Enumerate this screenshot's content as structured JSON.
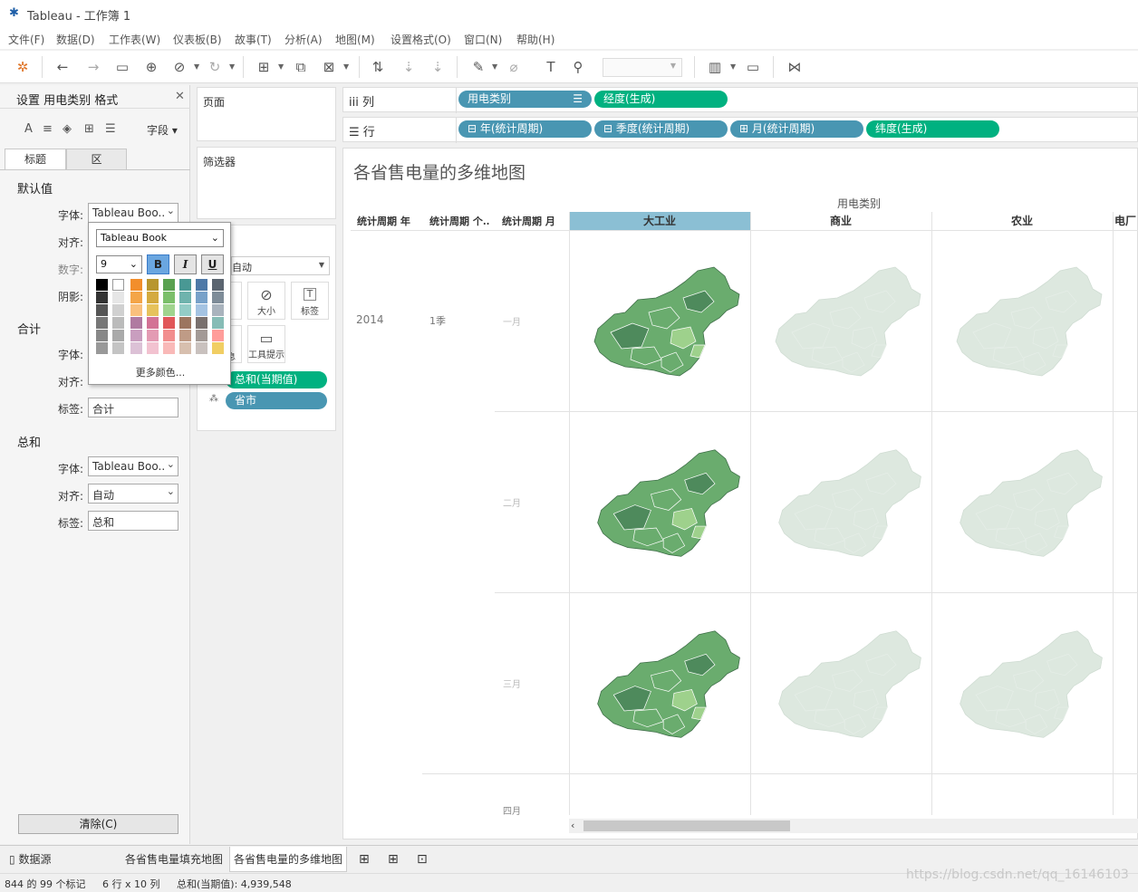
{
  "window": {
    "title": "Tableau - 工作簿 1"
  },
  "menu": [
    "文件(F)",
    "数据(D)",
    "工作表(W)",
    "仪表板(B)",
    "故事(T)",
    "分析(A)",
    "地图(M)",
    "设置格式(O)",
    "窗口(N)",
    "帮助(H)"
  ],
  "format_pane": {
    "title": "设置 用电类别 格式",
    "fields_label": "字段",
    "tabs": [
      "标题",
      "区"
    ],
    "default_section": "默认值",
    "font_label": "字体:",
    "align_label": "对齐:",
    "number_label": "数字:",
    "shading_label": "阴影:",
    "default_font_value": "Tableau Boo..",
    "subtotal_section": "合计",
    "subtotal_label_label": "标签:",
    "subtotal_label_value": "合计",
    "total_section": "总和",
    "total_font_value": "Tableau Boo..",
    "total_align_value": "自动",
    "total_label_value": "总和",
    "clear_button": "清除(C)"
  },
  "font_popup": {
    "font_name": "Tableau Book",
    "font_size": "9",
    "bold": "B",
    "italic": "I",
    "underline": "U",
    "more_colors": "更多颜色...",
    "swatch_colors": [
      [
        "#000000",
        "#ffffff",
        "#f28e2b",
        "#b8962e",
        "#59a14f",
        "#499894",
        "#4e79a7",
        "#5b6570"
      ],
      [
        "#333333",
        "#e6e6e6",
        "#f4a548",
        "#d4aa3f",
        "#7bbf6a",
        "#6fb3ad",
        "#77a1c9",
        "#7e8c98"
      ],
      [
        "#555555",
        "#d0d0d0",
        "#f9c07d",
        "#e6c25c",
        "#a0d48e",
        "#93ccc6",
        "#a4c3e2",
        "#a9b3bd"
      ],
      [
        "#777777",
        "#bbbbbb",
        "#b07aa1",
        "#d37295",
        "#e15759",
        "#9c755f",
        "#79706e",
        "#86bcb6"
      ],
      [
        "#888888",
        "#aaaaaa",
        "#c99ebf",
        "#e39bb3",
        "#f28e8e",
        "#bf9b86",
        "#a39a96",
        "#ff9d9a"
      ],
      [
        "#999999",
        "#c4c4c4",
        "#dcc1d6",
        "#f2c2d0",
        "#f9b9b8",
        "#d7bfae",
        "#c9c1be",
        "#f1ce63"
      ]
    ]
  },
  "cards": {
    "pages": "页面",
    "filters": "筛选器",
    "marks_type": "自动",
    "marks_buttons": [
      "大小",
      "标签",
      "工具提示"
    ],
    "marks_partial": "息",
    "marks_pills": [
      "总和(当期值)",
      "省市"
    ]
  },
  "shelves": {
    "columns_label": "列",
    "rows_label": "行",
    "columns": [
      "用电类别",
      "经度(生成)"
    ],
    "rows": [
      "年(统计周期)",
      "季度(统计周期)",
      "月(统计周期)",
      "纬度(生成)"
    ]
  },
  "view": {
    "title": "各省售电量的多维地图",
    "category_header": "用电类别",
    "row_headers": [
      "统计周期 年",
      "统计周期 个..",
      "统计周期 月"
    ],
    "categories": [
      "大工业",
      "商业",
      "农业",
      "电厂"
    ],
    "year": "2014",
    "quarter": "1季",
    "months": [
      "一月",
      "二月",
      "三月",
      "四月"
    ]
  },
  "colors": {
    "pill_blue": "#4996b2",
    "pill_green": "#00b180",
    "map_dark": "#4e8a5c",
    "map_mid": "#6aac6e",
    "map_light": "#9ed18c",
    "map_faded": "#dde8df",
    "selected_header": "#8bbfd4"
  },
  "sheet_tabs": [
    "数据源",
    "各省售电量填充地图",
    "各省售电量的多维地图"
  ],
  "status": {
    "marks": "844 的 99 个标记",
    "dims": "6 行 x 10 列",
    "sum": "总和(当期值): 4,939,548"
  },
  "watermark": "https://blog.csdn.net/qq_16146103"
}
